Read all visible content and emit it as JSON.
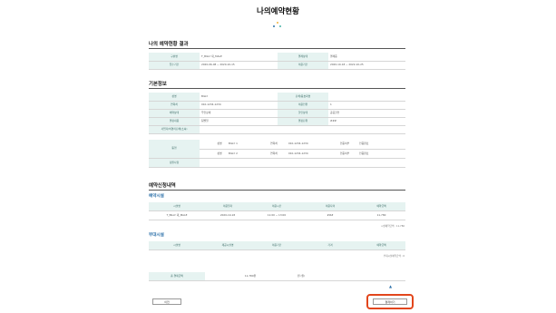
{
  "page_title": "나의예약현황",
  "colors": {
    "accent": "#2a6fa8",
    "header_bg": "#e6f3f1",
    "highlight_border": "#e2461c"
  },
  "result_section": {
    "title": "나의 예약현황 결과",
    "rows": [
      [
        "구분명",
        "T_BILLY 대_MALE",
        "결제상태",
        "결제중"
      ],
      [
        "접수기간",
        "2020-06-08 ~ 2020-10-15",
        "이용기간",
        "2020-10-18 ~ 2022-10-25"
      ]
    ]
  },
  "basic_section": {
    "title": "기본정보",
    "rows": [
      [
        "성명",
        "BILLY",
        "단체/동호회명",
        ""
      ],
      [
        "연락처",
        "010-1234-1234",
        "이용인원",
        "1"
      ],
      [
        "예약상태",
        "무인장세",
        "할인상태",
        "공공할인"
      ],
      [
        "결정내용",
        "팀별일",
        "결정단위",
        "###"
      ],
      [
        "사업자/비영리단체(소속)",
        "",
        "",
        ""
      ]
    ],
    "member_label": "동행",
    "member_rows": [
      [
        "성명",
        "BILLY 1",
        "연락처",
        "010-1234-1234",
        "인증여부",
        "인증완료"
      ],
      [
        "성명",
        "BILLY 2",
        "연락처",
        "010-1234-1234",
        "인증여부",
        "인증완료"
      ]
    ],
    "memo_label": "정원사항"
  },
  "apply_section": {
    "title": "예약신청내역",
    "facility": {
      "title": "예약시설",
      "headers": [
        "시설명",
        "이용일자",
        "이용시간",
        "이용자격",
        "예약금액"
      ],
      "row": [
        "T_BILLY 대_MALE",
        "2020-10-18",
        "11:00 ~ 13:00",
        "###",
        "11,780"
      ],
      "note": "시설예약금액 : 11,780"
    },
    "extra": {
      "title": "부대시설",
      "headers": [
        "시설명",
        "제공시설명",
        "이용기간",
        "가격",
        "예약금액"
      ],
      "note": "부대시설예약금액 : 0"
    },
    "total_label": "총 결제금액",
    "total_value": "11,780원",
    "total_unit": "원 (원)"
  },
  "buttons": {
    "back": "이전",
    "next": "결제하기"
  }
}
